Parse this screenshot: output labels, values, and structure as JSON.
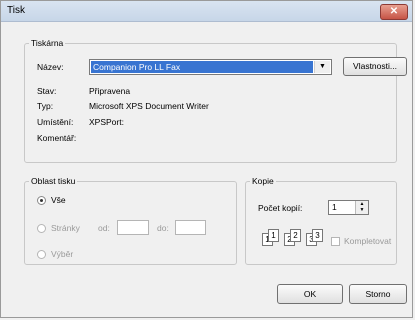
{
  "window": {
    "title": "Tisk",
    "close": "✕"
  },
  "printer": {
    "legend": "Tiskárna",
    "name_label": "Název:",
    "name_value": "Companion Pro LL Fax",
    "properties_button": "Vlastnosti...",
    "rows": [
      {
        "label": "Stav:",
        "value": "Připravena"
      },
      {
        "label": "Typ:",
        "value": "Microsoft XPS Document Writer"
      },
      {
        "label": "Umístění:",
        "value": "XPSPort:"
      },
      {
        "label": "Komentář:",
        "value": ""
      }
    ]
  },
  "range": {
    "legend": "Oblast tisku",
    "all": "Vše",
    "pages": "Stránky",
    "from": "od:",
    "to": "do:",
    "selection": "Výběr"
  },
  "copies": {
    "legend": "Kopie",
    "count_label": "Počet kopií:",
    "count_value": "1",
    "collate": "Kompletovat"
  },
  "buttons": {
    "ok": "OK",
    "cancel": "Storno"
  }
}
